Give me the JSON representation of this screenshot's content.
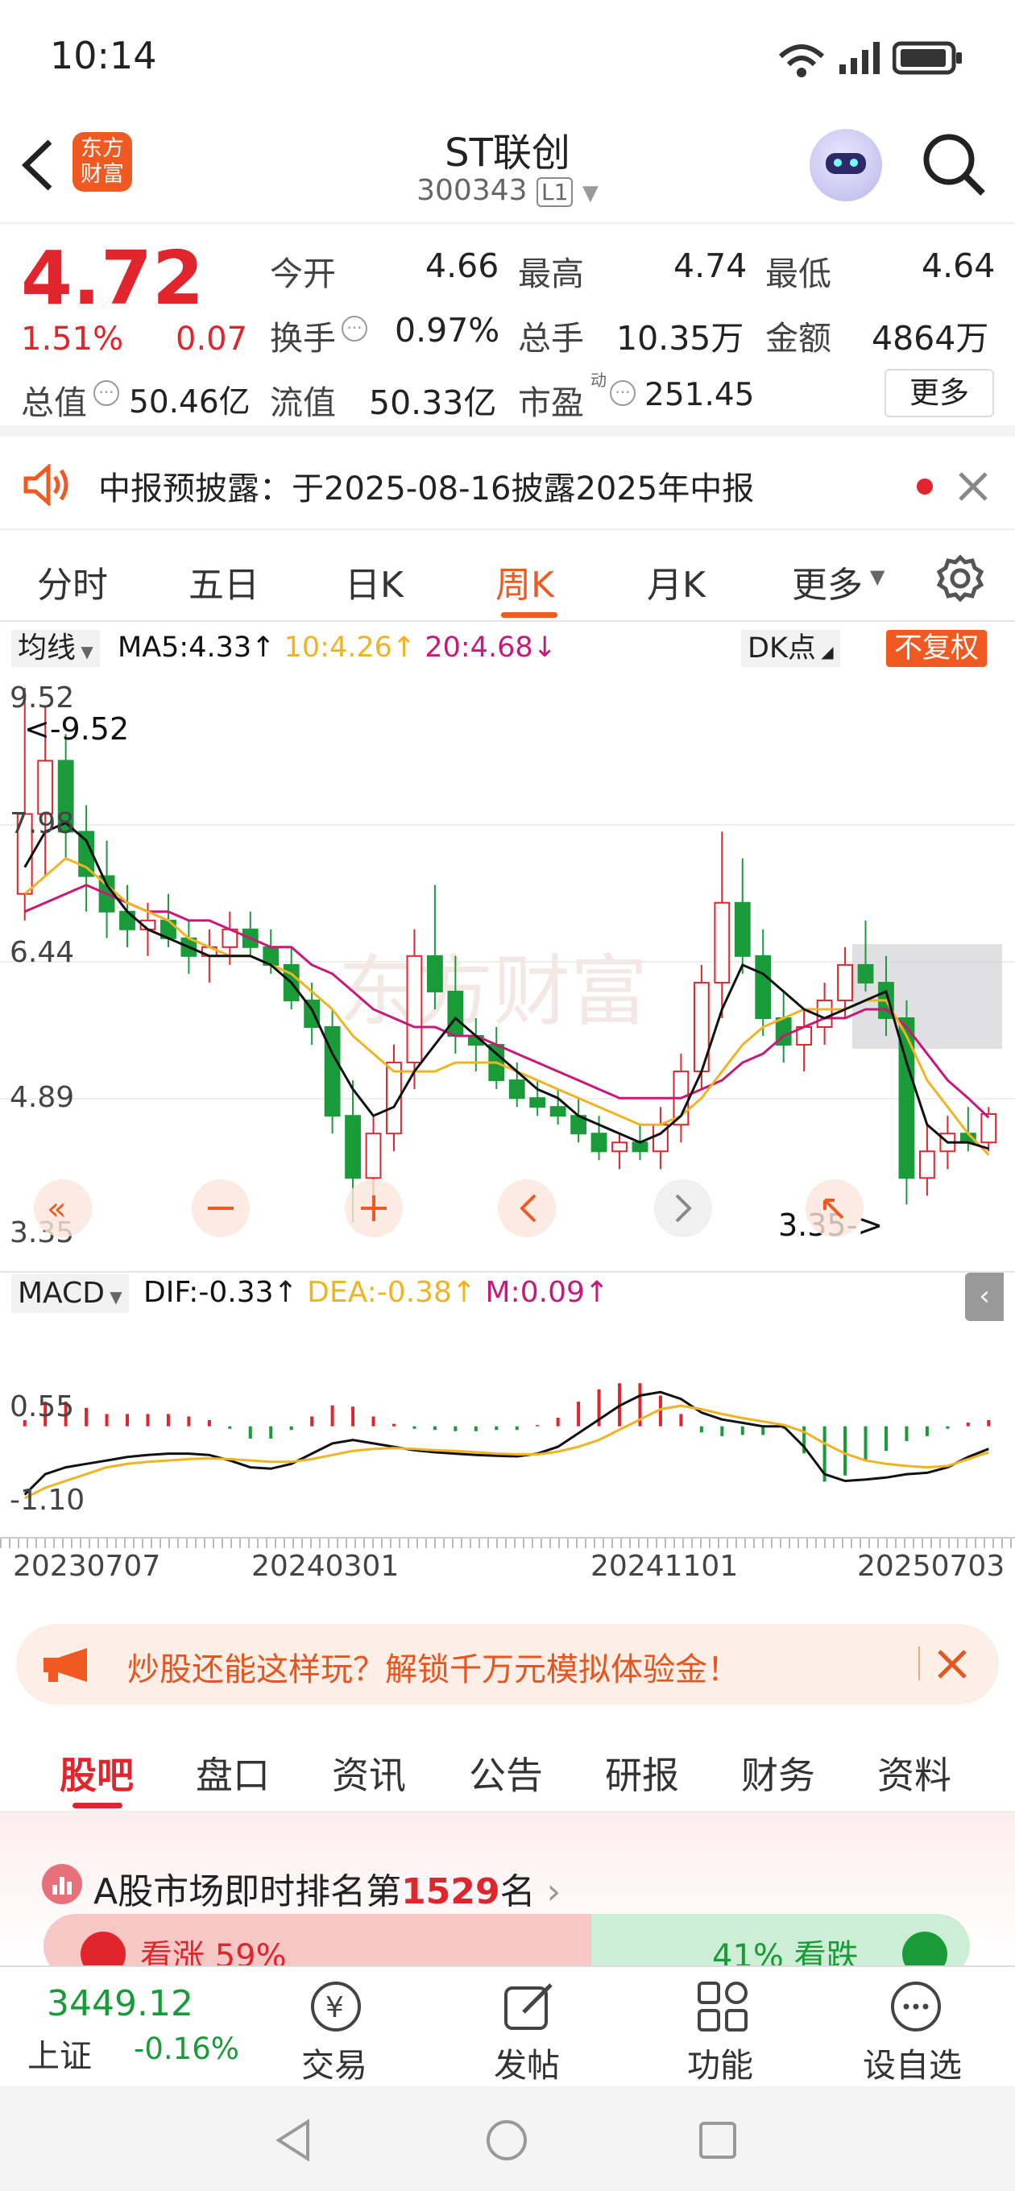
{
  "status": {
    "time": "10:14"
  },
  "header": {
    "logo_line1": "东方",
    "logo_line2": "财富",
    "title": "ST联创",
    "code": "300343",
    "badge": "L1"
  },
  "quote": {
    "price": "4.72",
    "change_pct": "1.51%",
    "change": "0.07",
    "open_label": "今开",
    "open": "4.66",
    "high_label": "最高",
    "high": "4.74",
    "low_label": "最低",
    "low": "4.64",
    "turnover_label": "换手",
    "turnover": "0.97%",
    "volume_label": "总手",
    "volume": "10.35万",
    "amount_label": "金额",
    "amount": "4864万",
    "mktcap_label": "总值",
    "mktcap": "50.46亿",
    "float_label": "流值",
    "float": "50.33亿",
    "pe_label": "市盈",
    "pe_sup": "动",
    "pe": "251.45",
    "more": "更多"
  },
  "notice": {
    "text": "中报预披露：于2025-08-16披露2025年中报"
  },
  "period_tabs": [
    "分时",
    "五日",
    "日K",
    "周K",
    "月K",
    "更多"
  ],
  "active_tab": "周K",
  "chart": {
    "ma_select": "均线",
    "ma5": "MA5:4.33",
    "ma10": "10:4.26",
    "ma20": "20:4.68",
    "dk": "DK点",
    "fuquan": "不复权",
    "y_labels": [
      "9.52",
      "7.98",
      "6.44",
      "4.89",
      "3.35"
    ],
    "high_mark": "<-9.52",
    "low_mark": "3.35->",
    "watermark": "东方财富",
    "macd_select": "MACD",
    "dif": "DIF:-0.33",
    "dea": "DEA:-0.38",
    "m": "M:0.09",
    "macd_y": [
      "0.55",
      "-1.10"
    ],
    "x_labels": [
      "20230707",
      "20240301",
      "20241101",
      "20250703"
    ],
    "colors": {
      "up": "#e0262c",
      "down": "#1a9b3a",
      "ma5": "#111111",
      "ma10": "#f0b323",
      "ma20": "#c8187a"
    }
  },
  "chart_data": {
    "type": "candlestick",
    "x_start": "20230707",
    "x_end": "20250703",
    "ylim": [
      3.35,
      9.52
    ],
    "candles_ohlc": [
      [
        7.2,
        9.52,
        6.9,
        8.1
      ],
      [
        8.1,
        9.3,
        7.4,
        8.7
      ],
      [
        8.7,
        9.0,
        7.6,
        7.9
      ],
      [
        7.9,
        8.2,
        7.0,
        7.4
      ],
      [
        7.4,
        7.8,
        6.7,
        7.0
      ],
      [
        7.0,
        7.3,
        6.6,
        6.8
      ],
      [
        6.8,
        7.1,
        6.5,
        6.9
      ],
      [
        6.9,
        7.2,
        6.6,
        6.7
      ],
      [
        6.7,
        6.9,
        6.3,
        6.5
      ],
      [
        6.5,
        6.8,
        6.2,
        6.6
      ],
      [
        6.6,
        7.0,
        6.4,
        6.8
      ],
      [
        6.8,
        7.0,
        6.5,
        6.6
      ],
      [
        6.6,
        6.8,
        6.3,
        6.4
      ],
      [
        6.4,
        6.6,
        5.9,
        6.0
      ],
      [
        6.0,
        6.2,
        5.5,
        5.7
      ],
      [
        5.7,
        5.9,
        4.5,
        4.7
      ],
      [
        4.7,
        5.1,
        3.5,
        4.0
      ],
      [
        4.0,
        4.7,
        3.7,
        4.5
      ],
      [
        4.5,
        5.5,
        4.3,
        5.3
      ],
      [
        5.3,
        6.8,
        5.0,
        6.5
      ],
      [
        6.5,
        7.3,
        5.9,
        6.1
      ],
      [
        6.1,
        6.5,
        5.4,
        5.6
      ],
      [
        5.6,
        5.8,
        5.2,
        5.5
      ],
      [
        5.5,
        5.7,
        5.0,
        5.1
      ],
      [
        5.1,
        5.3,
        4.8,
        4.9
      ],
      [
        4.9,
        5.1,
        4.7,
        4.8
      ],
      [
        4.8,
        5.0,
        4.6,
        4.7
      ],
      [
        4.7,
        4.9,
        4.4,
        4.5
      ],
      [
        4.5,
        4.7,
        4.2,
        4.3
      ],
      [
        4.3,
        4.5,
        4.1,
        4.4
      ],
      [
        4.4,
        4.6,
        4.2,
        4.3
      ],
      [
        4.3,
        4.8,
        4.1,
        4.6
      ],
      [
        4.6,
        5.4,
        4.4,
        5.2
      ],
      [
        5.2,
        6.4,
        5.0,
        6.2
      ],
      [
        6.2,
        7.9,
        5.8,
        7.1
      ],
      [
        7.1,
        7.6,
        6.3,
        6.5
      ],
      [
        6.5,
        6.8,
        5.6,
        5.8
      ],
      [
        5.8,
        6.1,
        5.3,
        5.5
      ],
      [
        5.5,
        5.9,
        5.2,
        5.7
      ],
      [
        5.7,
        6.2,
        5.5,
        6.0
      ],
      [
        6.0,
        6.6,
        5.8,
        6.4
      ],
      [
        6.4,
        6.9,
        6.1,
        6.2
      ],
      [
        6.2,
        6.5,
        5.6,
        5.8
      ],
      [
        5.8,
        6.0,
        3.7,
        4.0
      ],
      [
        4.0,
        4.6,
        3.8,
        4.3
      ],
      [
        4.3,
        4.7,
        4.1,
        4.5
      ],
      [
        4.5,
        4.8,
        4.3,
        4.4
      ],
      [
        4.4,
        4.8,
        4.3,
        4.72
      ]
    ],
    "ma5": [
      7.5,
      7.9,
      8.0,
      7.8,
      7.3,
      7.0,
      6.8,
      6.7,
      6.6,
      6.5,
      6.5,
      6.5,
      6.4,
      6.2,
      5.9,
      5.4,
      5.0,
      4.7,
      4.8,
      5.2,
      5.5,
      5.8,
      5.6,
      5.4,
      5.2,
      5.0,
      4.9,
      4.7,
      4.6,
      4.5,
      4.4,
      4.5,
      4.7,
      5.2,
      5.9,
      6.4,
      6.3,
      6.1,
      5.9,
      5.8,
      5.9,
      6.0,
      6.1,
      5.3,
      4.6,
      4.4,
      4.4,
      4.33
    ],
    "ma10": [
      7.2,
      7.4,
      7.6,
      7.5,
      7.3,
      7.1,
      7.0,
      6.9,
      6.7,
      6.6,
      6.5,
      6.5,
      6.4,
      6.3,
      6.1,
      5.9,
      5.6,
      5.4,
      5.2,
      5.2,
      5.2,
      5.3,
      5.3,
      5.3,
      5.2,
      5.1,
      5.0,
      4.9,
      4.8,
      4.7,
      4.6,
      4.6,
      4.7,
      4.9,
      5.2,
      5.5,
      5.7,
      5.8,
      5.9,
      5.9,
      5.9,
      6.0,
      6.0,
      5.6,
      5.1,
      4.8,
      4.5,
      4.26
    ],
    "ma20": [
      7.0,
      7.1,
      7.2,
      7.3,
      7.2,
      7.1,
      7.0,
      7.0,
      6.9,
      6.9,
      6.8,
      6.7,
      6.6,
      6.6,
      6.4,
      6.3,
      6.1,
      5.9,
      5.8,
      5.7,
      5.7,
      5.6,
      5.6,
      5.5,
      5.4,
      5.3,
      5.2,
      5.1,
      5.0,
      4.9,
      4.9,
      4.9,
      4.9,
      5.0,
      5.1,
      5.3,
      5.4,
      5.6,
      5.7,
      5.8,
      5.8,
      5.9,
      5.9,
      5.7,
      5.4,
      5.1,
      4.9,
      4.68
    ],
    "macd_ylim": [
      -1.1,
      0.55
    ],
    "dif": [
      -1.0,
      -0.7,
      -0.6,
      -0.55,
      -0.5,
      -0.45,
      -0.42,
      -0.4,
      -0.4,
      -0.42,
      -0.5,
      -0.6,
      -0.62,
      -0.55,
      -0.4,
      -0.25,
      -0.2,
      -0.25,
      -0.3,
      -0.35,
      -0.38,
      -0.4,
      -0.42,
      -0.43,
      -0.44,
      -0.4,
      -0.3,
      -0.1,
      0.1,
      0.3,
      0.45,
      0.5,
      0.4,
      0.2,
      0.1,
      0.05,
      0.0,
      0.0,
      -0.3,
      -0.7,
      -0.8,
      -0.78,
      -0.75,
      -0.7,
      -0.68,
      -0.6,
      -0.45,
      -0.33
    ],
    "dea": [
      -1.05,
      -0.9,
      -0.8,
      -0.7,
      -0.6,
      -0.55,
      -0.52,
      -0.5,
      -0.48,
      -0.47,
      -0.48,
      -0.5,
      -0.52,
      -0.52,
      -0.48,
      -0.42,
      -0.36,
      -0.33,
      -0.32,
      -0.33,
      -0.35,
      -0.36,
      -0.38,
      -0.4,
      -0.41,
      -0.41,
      -0.37,
      -0.3,
      -0.2,
      -0.05,
      0.1,
      0.25,
      0.3,
      0.25,
      0.18,
      0.12,
      0.07,
      0.02,
      -0.08,
      -0.25,
      -0.4,
      -0.5,
      -0.55,
      -0.58,
      -0.6,
      -0.58,
      -0.48,
      -0.38
    ]
  },
  "ad": {
    "text": "炒股还能这样玩？解锁千万元模拟体验金！"
  },
  "content_tabs": [
    "股吧",
    "盘口",
    "资讯",
    "公告",
    "研报",
    "财务",
    "资料"
  ],
  "active_content_tab": "股吧",
  "rank": {
    "prefix": "A股市场即时排名第",
    "rank": "1529",
    "suffix": "名",
    "up": "看涨 59%",
    "down": "41% 看跌"
  },
  "bottom": {
    "index_value": "3449.12",
    "index_name": "上证",
    "index_change": "-0.16%",
    "items": [
      {
        "label": "交易"
      },
      {
        "label": "发帖"
      },
      {
        "label": "功能"
      },
      {
        "label": "设自选"
      }
    ]
  }
}
